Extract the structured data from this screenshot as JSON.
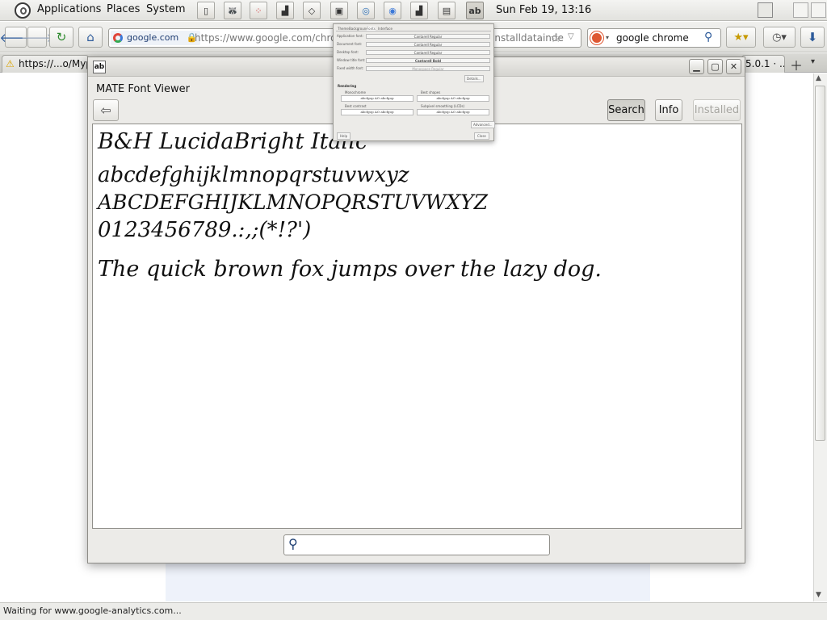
{
  "panel": {
    "menus": [
      "Applications",
      "Places",
      "System"
    ],
    "launchers": [
      "window-1",
      "raccoon-icon",
      "dots-icon",
      "chart-icon",
      "diamond-icon",
      "monitor-icon",
      "gecko-icon",
      "chrome-icon",
      "chart-icon-2",
      "terminal-icon",
      "font-viewer-icon"
    ],
    "clock": "Sun Feb 19, 13:16"
  },
  "browser": {
    "site_chip": "google.com",
    "url_start": "https://www.google.com/chrome/",
    "url_end": "installdatainde",
    "search_text": "google chrome",
    "tabs": [
      {
        "label": "https://...o/Mypal"
      },
      {
        "label": "5.0.1 · ..."
      }
    ],
    "status": "Waiting for www.google-analytics.com..."
  },
  "font_viewer": {
    "app_icon_label": "ab",
    "heading": "MATE Font Viewer",
    "buttons": {
      "search": "Search",
      "info": "Info",
      "installed": "Installed"
    },
    "preview": {
      "font_name": "B&H LucidaBright Italic",
      "lowercase": "abcdefghijklmnopqrstuvwxyz",
      "uppercase": "ABCDEFGHIJKLMNOPQRSTUVWXYZ",
      "digits": "0123456789.:,;(*!?')",
      "pangram": "The quick brown fox jumps over the lazy dog."
    },
    "search_placeholder": ""
  },
  "pref_dialog": {
    "tabs": [
      "Theme",
      "Background",
      "Fonts",
      "Interface"
    ],
    "rows": [
      {
        "label": "Application font:",
        "value": "Cantarell Regular"
      },
      {
        "label": "Document font:",
        "value": "Cantarell Regular"
      },
      {
        "label": "Desktop font:",
        "value": "Cantarell Regular"
      },
      {
        "label": "Window title font:",
        "value": "Cantarell Bold"
      },
      {
        "label": "Fixed width font:",
        "value": "Monospace Regular"
      }
    ],
    "details_button": "Details...",
    "rendering_label": "Rendering",
    "options": [
      "Monochrome",
      "Best shapes",
      "Best contrast",
      "Subpixel smoothing (LCDs)"
    ],
    "sample": "abcfgop AO abcfgop",
    "advanced_button": "Advanced...",
    "help_button": "Help",
    "close_button": "Close"
  }
}
